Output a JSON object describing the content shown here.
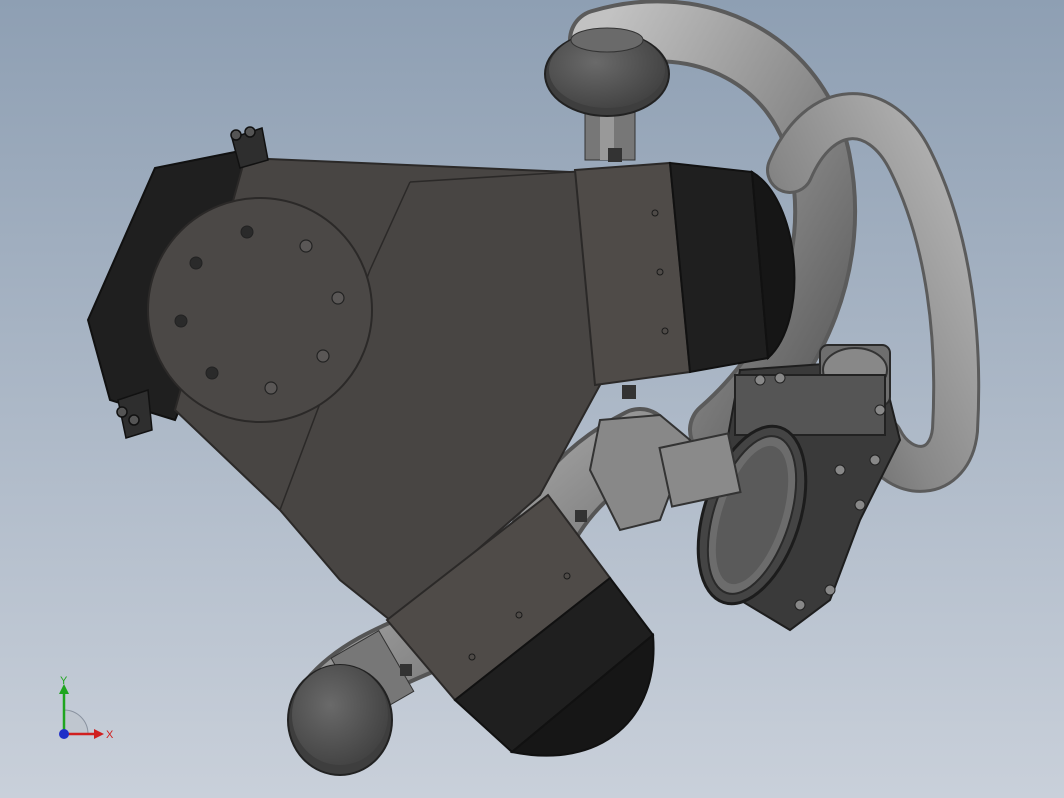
{
  "viewport": {
    "background_top": "#8e9fb3",
    "background_bottom": "#c9d0da"
  },
  "model": {
    "colors": {
      "body": "#474442",
      "body_edge": "#2c2a29",
      "cap_dark": "#1c1c1c",
      "pipe": "#8f8f8f",
      "pipe_light": "#b5b5b5",
      "pipe_dark": "#5f5f5f",
      "flange": "#4a4a4a",
      "hole": "#2a2a2a"
    }
  },
  "triad": {
    "x_label": "X",
    "y_label": "Y",
    "x_color": "#d01f1f",
    "y_color": "#1fa51f",
    "z_color": "#1f2fc8"
  }
}
